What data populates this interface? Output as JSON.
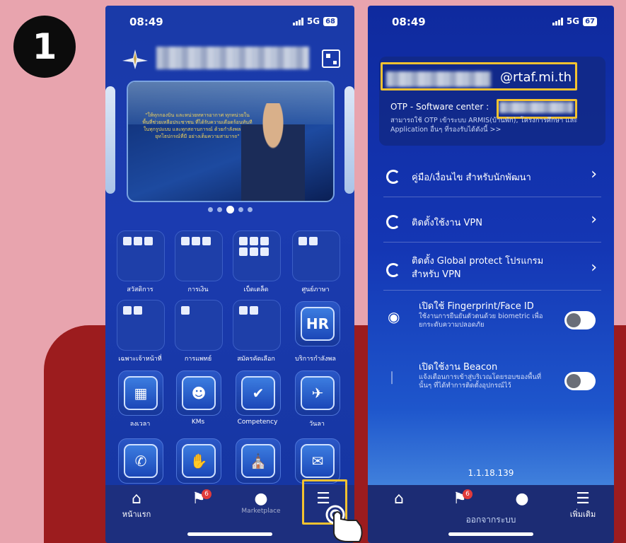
{
  "step_number": "1",
  "phone1": {
    "status": {
      "time": "08:49",
      "network": "5G",
      "battery": "68"
    },
    "banner_text": "\"ให้ทุกกองบิน และหน่วยทหารอากาศ ทุกหน่วยในพื้นที่ช่วยเหลือประชาชน ที่ได้รับความเดือดร้อนทันทีในทุกรูปแบบ และทุกสถานการณ์ ด้วยกำลังพล และยุทโธปกรณ์ที่มี อย่างเต็มความสามารถ\"",
    "grid_items": [
      "สวัสดิการ",
      "การเงิน",
      "เบ็ดเตล็ด",
      "ศูนย์ภาษา",
      "เฉพาะเจ้าหน้าที่",
      "การแพทย์",
      "สมัครคัดเลือก",
      "บริการกำลังพล",
      "ลงเวลา",
      "KMs",
      "Competency",
      "วันลา"
    ],
    "hr_icon_text": "HR",
    "tabs": [
      {
        "label": "หน้าแรก",
        "icon": "home-icon"
      },
      {
        "label": "",
        "icon": "bell-icon",
        "badge": "6"
      },
      {
        "label": "",
        "icon": "user-icon"
      },
      {
        "label": "",
        "icon": "menu-icon"
      }
    ],
    "partial_labels": [
      "Marketplace"
    ]
  },
  "phone2": {
    "status": {
      "time": "08:49",
      "network": "5G",
      "battery": "67"
    },
    "email_domain": "@rtaf.mi.th",
    "otp_label": "OTP - Software center : ",
    "otp_desc": "สามารถใช้ OTP เข้าระบบ ARMIS(บ้านพัก), โครงการศึกษา และ Application อื่นๆ ที่รองรับได้ดังนี้ >>",
    "menu": [
      {
        "label": "คู่มือ/เงื่อนไข สำหรับนักพัฒนา"
      },
      {
        "label": "ติดตั้งใช้งาน VPN"
      },
      {
        "label": "ติดตั้ง Global protect โปรแกรม สำหรับ VPN"
      }
    ],
    "toggles": [
      {
        "title": "เปิดใช้ Fingerprint/Face ID",
        "desc": "ใช้งานการยืนยันตัวตนด้วย biometric เพื่อยกระดับความปลอดภัย",
        "icon": "fingerprint-icon",
        "on": false
      },
      {
        "title": "เปิดใช้งาน Beacon",
        "desc": "แจ้งเตือนการเข้าสู่บริเวณโดยรอบของพื้นที่นั้นๆ ที่ได้ทำการติดตั้งอุปกรณ์ไว้",
        "icon": "bluetooth-icon",
        "on": false
      }
    ],
    "version": "1.1.18.139",
    "logout": "ออกจากระบบ",
    "tabs": [
      {
        "label": "",
        "icon": "home-icon"
      },
      {
        "label": "",
        "icon": "bell-icon",
        "badge": "6"
      },
      {
        "label": "",
        "icon": "user-icon"
      },
      {
        "label": "เพิ่มเติม",
        "icon": "menu-icon"
      }
    ]
  },
  "colors": {
    "highlight": "#f2c230",
    "background": "#e8a4ae",
    "red_panel": "#9c1c1e"
  }
}
